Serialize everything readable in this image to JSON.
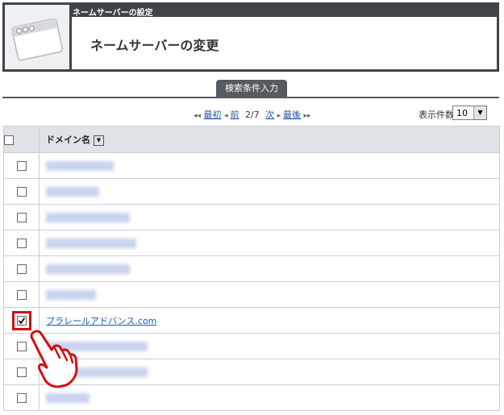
{
  "header": {
    "section": "ネームサーバーの設定",
    "title": "ネームサーバーの変更"
  },
  "search_tab": "検索条件入力",
  "pager": {
    "first": "最初",
    "prev": "前",
    "page": "2/7",
    "next": "次",
    "last": "最後",
    "per_page_label": "表示件数",
    "per_page_value": "10"
  },
  "table": {
    "column_domain": "ドメイン名",
    "rows": [
      {
        "checked": false,
        "domain": null
      },
      {
        "checked": false,
        "domain": null
      },
      {
        "checked": false,
        "domain": null
      },
      {
        "checked": false,
        "domain": null
      },
      {
        "checked": false,
        "domain": null
      },
      {
        "checked": false,
        "domain": null
      },
      {
        "checked": true,
        "domain": "プラレールアドバンス.com"
      },
      {
        "checked": false,
        "domain": null
      },
      {
        "checked": false,
        "domain": null
      },
      {
        "checked": false,
        "domain": null
      }
    ]
  },
  "colors": {
    "header_bg": "#3f4448",
    "highlight": "#d01010",
    "link": "#2255aa"
  }
}
